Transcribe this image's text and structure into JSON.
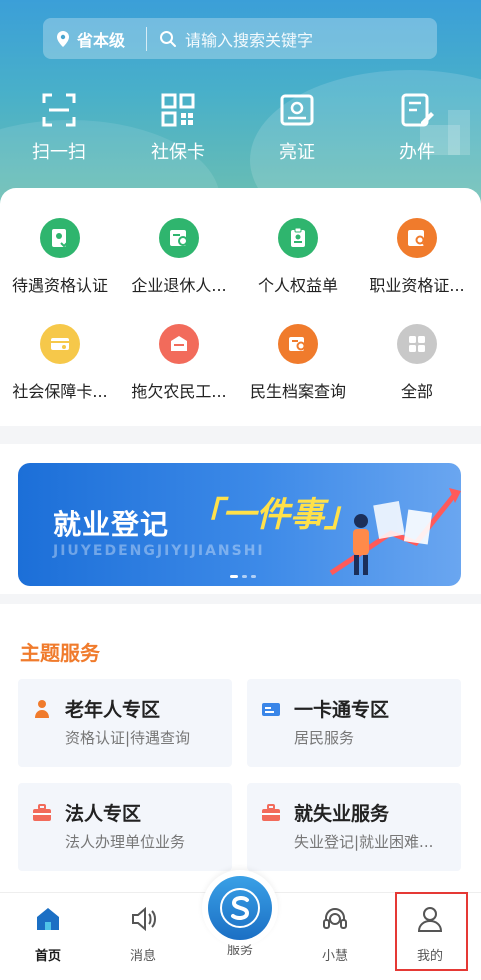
{
  "search": {
    "location": "省本级",
    "placeholder": "请输入搜索关键字"
  },
  "quick_actions": [
    {
      "label": "扫一扫",
      "icon": "scan-icon"
    },
    {
      "label": "社保卡",
      "icon": "qr-code-icon"
    },
    {
      "label": "亮证",
      "icon": "certificate-icon"
    },
    {
      "label": "办件",
      "icon": "edit-document-icon"
    }
  ],
  "services": [
    {
      "label": "待遇资格认证",
      "icon": "certification-icon",
      "color": "#2fb56e"
    },
    {
      "label": "企业退休人...",
      "icon": "retiree-icon",
      "color": "#2fb56e"
    },
    {
      "label": "个人权益单",
      "icon": "clipboard-icon",
      "color": "#2fb56e"
    },
    {
      "label": "职业资格证...",
      "icon": "license-search-icon",
      "color": "#f07b2c"
    },
    {
      "label": "社会保障卡...",
      "icon": "card-icon",
      "color": "#f6c84a"
    },
    {
      "label": "拖欠农民工...",
      "icon": "complaint-box-icon",
      "color": "#f26b5b"
    },
    {
      "label": "民生档案查询",
      "icon": "archive-search-icon",
      "color": "#f07b2c"
    },
    {
      "label": "全部",
      "icon": "grid-icon",
      "color": "#c8c8c8"
    }
  ],
  "banner": {
    "title": "就业登记",
    "highlight": "「一件事」",
    "subtitle": "JIUYEDENGJIYIJIANSHI"
  },
  "theme": {
    "title": "主题服务",
    "cards": [
      {
        "title": "老年人专区",
        "subtitle": "资格认证|待遇查询",
        "icon": "elderly-icon"
      },
      {
        "title": "一卡通专区",
        "subtitle": "居民服务",
        "icon": "card-icon"
      },
      {
        "title": "法人专区",
        "subtitle": "法人办理单位业务",
        "icon": "briefcase-icon"
      },
      {
        "title": "就失业服务",
        "subtitle": "失业登记|就业困难...",
        "icon": "briefcase-icon"
      }
    ]
  },
  "tabs": [
    {
      "label": "首页",
      "icon": "home-icon"
    },
    {
      "label": "消息",
      "icon": "speaker-icon"
    },
    {
      "label": "服务",
      "icon": "service-logo-icon"
    },
    {
      "label": "小慧",
      "icon": "headset-icon"
    },
    {
      "label": "我的",
      "icon": "user-icon"
    }
  ],
  "colors": {
    "accent_orange": "#f07b2c",
    "brand_blue": "#1b6fc4",
    "selection_red": "#e53935"
  }
}
